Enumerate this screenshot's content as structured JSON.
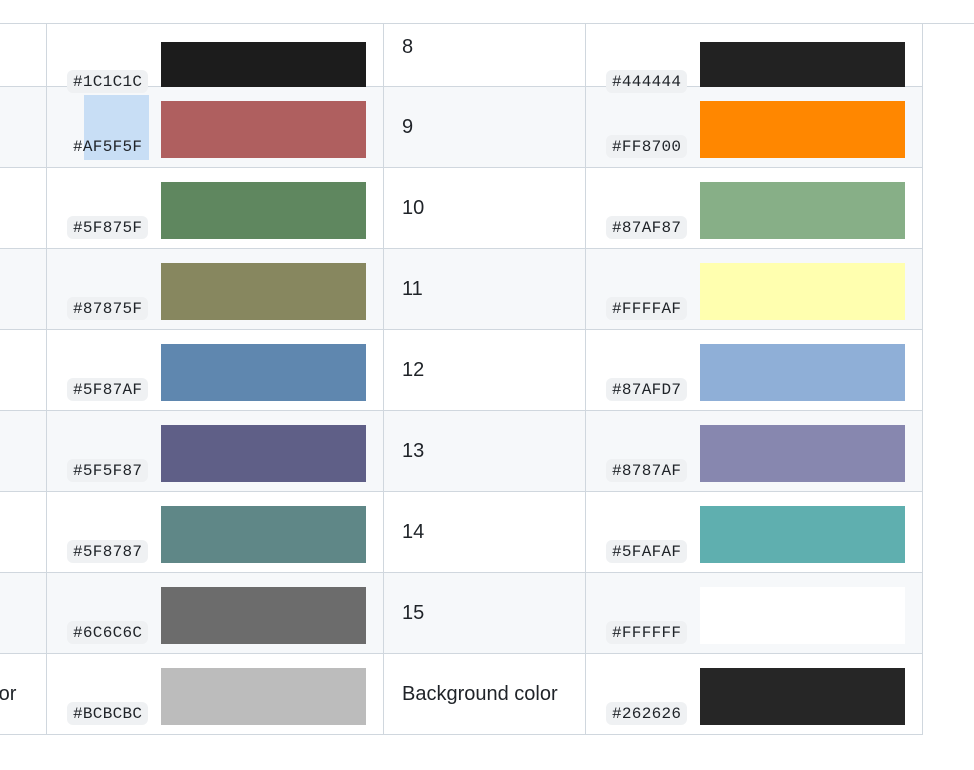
{
  "rows": [
    {
      "left_label": "",
      "left_hex": "#1C1C1C",
      "left_color": "#1C1C1C",
      "right_label": "8",
      "right_hex": "#444444",
      "right_color": "#222222"
    },
    {
      "left_label": "",
      "left_hex": "#AF5F5F",
      "left_color": "#AF5F5F",
      "right_label": "9",
      "right_hex": "#FF8700",
      "right_color": "#FF8700"
    },
    {
      "left_label": "",
      "left_hex": "#5F875F",
      "left_color": "#5F875F",
      "right_label": "10",
      "right_hex": "#87AF87",
      "right_color": "#87AF87"
    },
    {
      "left_label": "",
      "left_hex": "#87875F",
      "left_color": "#87875F",
      "right_label": "11",
      "right_hex": "#FFFFAF",
      "right_color": "#FFFFAF"
    },
    {
      "left_label": "",
      "left_hex": "#5F87AF",
      "left_color": "#5F87AF",
      "right_label": "12",
      "right_hex": "#87AFD7",
      "right_color": "#8FAFD7"
    },
    {
      "left_label": "",
      "left_hex": "#5F5F87",
      "left_color": "#5F5F87",
      "right_label": "13",
      "right_hex": "#8787AF",
      "right_color": "#8787AF"
    },
    {
      "left_label": "",
      "left_hex": "#5F8787",
      "left_color": "#5F8787",
      "right_label": "14",
      "right_hex": "#5FAFAF",
      "right_color": "#5FAFAF"
    },
    {
      "left_label": "",
      "left_hex": "#6C6C6C",
      "left_color": "#6C6C6C",
      "right_label": "15",
      "right_hex": "#FFFFFF",
      "right_color": "#FFFFFF"
    },
    {
      "left_label": "olor",
      "left_hex": "#BCBCBC",
      "left_color": "#BCBCBC",
      "right_label": "Background color",
      "right_hex": "#262626",
      "right_color": "#262626"
    }
  ]
}
